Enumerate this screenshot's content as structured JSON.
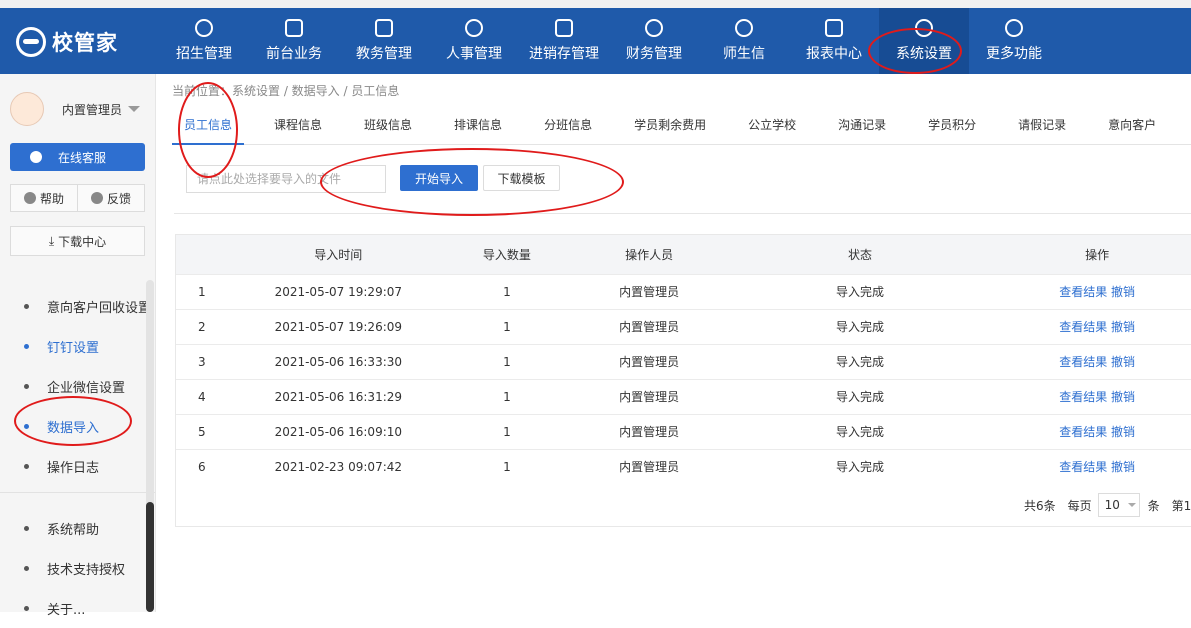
{
  "logo": {
    "text": "校管家"
  },
  "nav": [
    {
      "label": "招生管理",
      "icon": "user-plus-icon"
    },
    {
      "label": "前台业务",
      "icon": "window-icon"
    },
    {
      "label": "教务管理",
      "icon": "book-icon"
    },
    {
      "label": "人事管理",
      "icon": "person-icon"
    },
    {
      "label": "进销存管理",
      "icon": "box-arrow-icon"
    },
    {
      "label": "财务管理",
      "icon": "yuan-icon"
    },
    {
      "label": "师生信",
      "icon": "chat-icon"
    },
    {
      "label": "报表中心",
      "icon": "chart-icon"
    },
    {
      "label": "系统设置",
      "icon": "gear-icon",
      "active": true
    },
    {
      "label": "更多功能",
      "icon": "more-icon"
    }
  ],
  "sidebar": {
    "user_name": "内置管理员",
    "service_label": "在线客服",
    "help_label": "帮助",
    "feedback_label": "反馈",
    "download_label": "下载中心",
    "menu": [
      {
        "label": "意向客户回收设置"
      },
      {
        "label": "钉钉设置",
        "active": true
      },
      {
        "label": "企业微信设置"
      },
      {
        "label": "数据导入",
        "active": true
      },
      {
        "label": "操作日志"
      }
    ],
    "menu2": [
      {
        "label": "系统帮助"
      },
      {
        "label": "技术支持授权"
      },
      {
        "label": "关于..."
      }
    ]
  },
  "breadcrumb": "当前位置：系统设置 / 数据导入 / 员工信息",
  "tabs": [
    "员工信息",
    "课程信息",
    "班级信息",
    "排课信息",
    "分班信息",
    "学员剩余费用",
    "公立学校",
    "沟通记录",
    "学员积分",
    "请假记录",
    "意向客户"
  ],
  "import": {
    "file_placeholder": "请点此处选择要导入的文件",
    "start_label": "开始导入",
    "template_label": "下载模板"
  },
  "table": {
    "headers": [
      "",
      "导入时间",
      "导入数量",
      "操作人员",
      "状态",
      "操作"
    ],
    "view_label": "查看结果",
    "undo_label": "撤销",
    "rows": [
      {
        "idx": "1",
        "time": "2021-05-07 19:29:07",
        "count": "1",
        "operator": "内置管理员",
        "status": "导入完成"
      },
      {
        "idx": "2",
        "time": "2021-05-07 19:26:09",
        "count": "1",
        "operator": "内置管理员",
        "status": "导入完成"
      },
      {
        "idx": "3",
        "time": "2021-05-06 16:33:30",
        "count": "1",
        "operator": "内置管理员",
        "status": "导入完成"
      },
      {
        "idx": "4",
        "time": "2021-05-06 16:31:29",
        "count": "1",
        "operator": "内置管理员",
        "status": "导入完成"
      },
      {
        "idx": "5",
        "time": "2021-05-06 16:09:10",
        "count": "1",
        "operator": "内置管理员",
        "status": "导入完成"
      },
      {
        "idx": "6",
        "time": "2021-02-23 09:07:42",
        "count": "1",
        "operator": "内置管理员",
        "status": "导入完成"
      }
    ]
  },
  "pager": {
    "total": "共6条",
    "per_page_label": "每页",
    "page_size": "10",
    "unit": "条",
    "page": "第1"
  },
  "colors": {
    "topbar": "#1f5aaa",
    "accent": "#2e6fd0",
    "annotation": "#e01b1b"
  }
}
